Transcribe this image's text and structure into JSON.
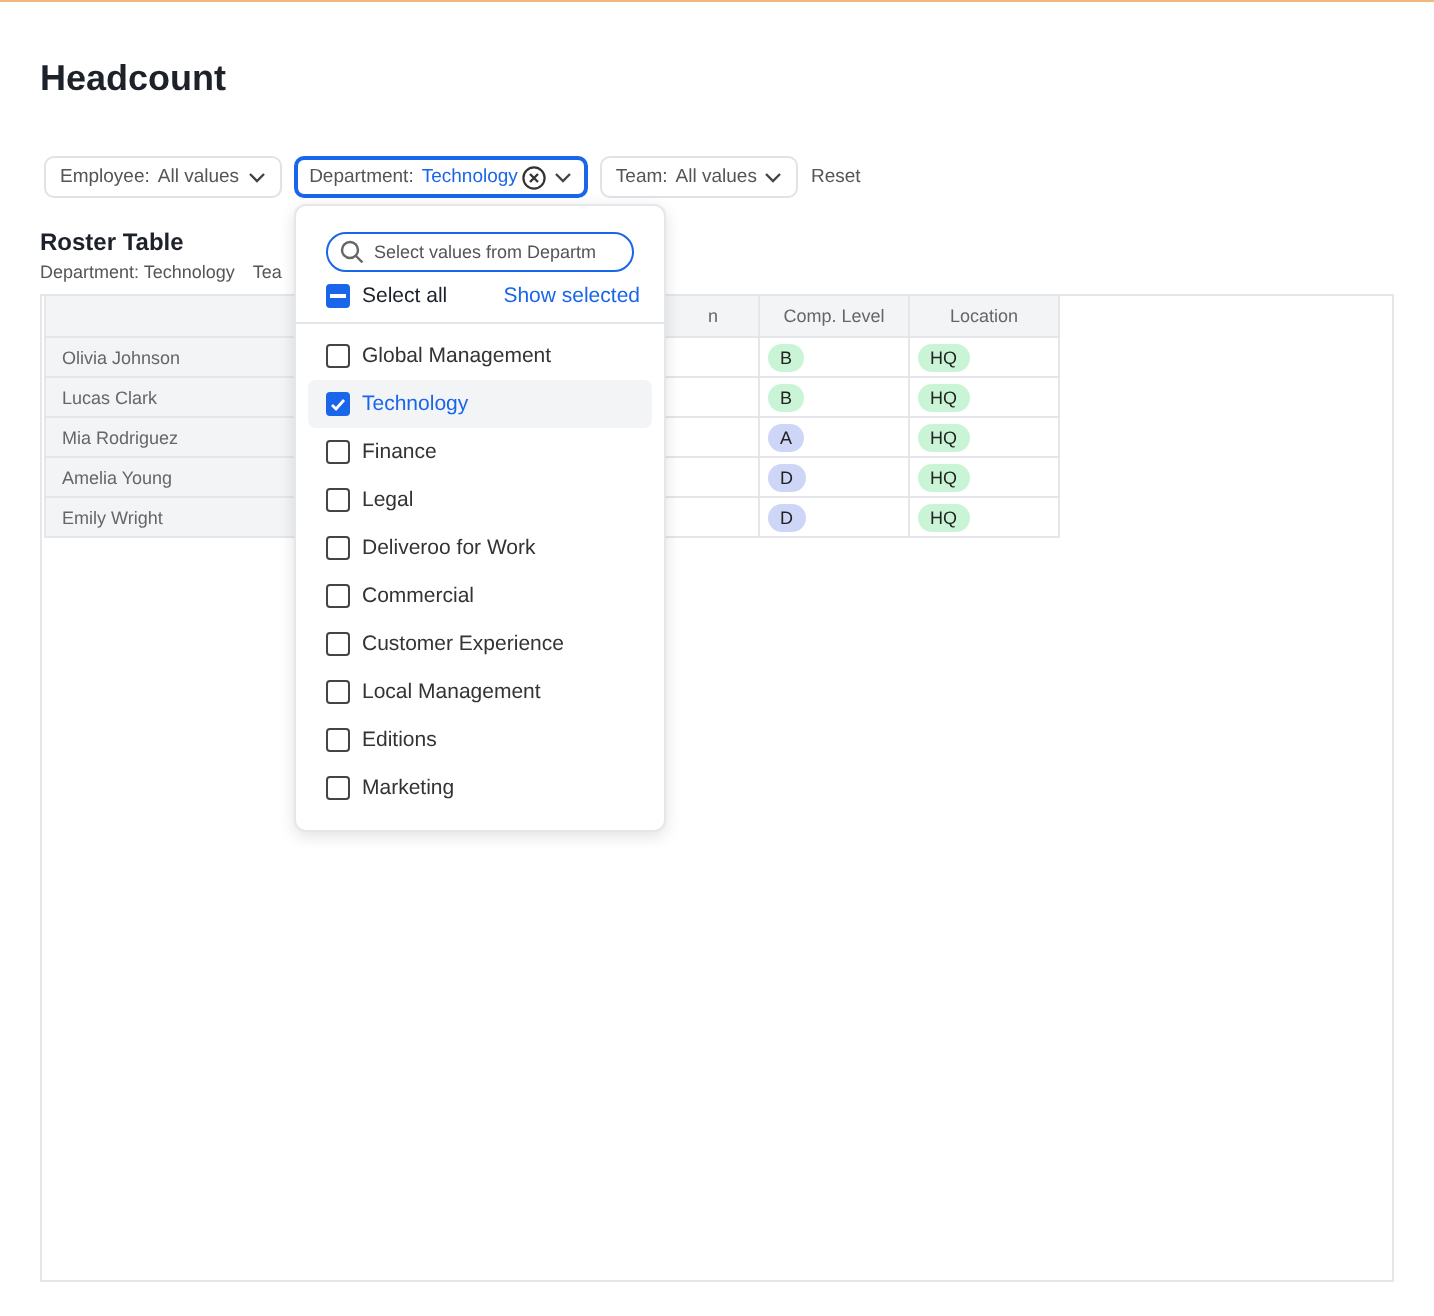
{
  "page": {
    "title": "Headcount"
  },
  "filters": [
    {
      "label": "Employee:",
      "value": "All values",
      "active": false,
      "clearable": false
    },
    {
      "label": "Department:",
      "value": "Technology",
      "active": true,
      "clearable": true
    },
    {
      "label": "Team:",
      "value": "All values",
      "active": false,
      "clearable": false
    }
  ],
  "reset": "Reset",
  "roster": {
    "title": "Roster Table",
    "subtitle": [
      "Department: Technology",
      "Tea"
    ],
    "columns": [
      "",
      "n",
      "Comp. Level",
      "Location"
    ],
    "rows": [
      {
        "name": "Olivia Johnson",
        "comp_level": {
          "text": "B",
          "color": "#c9f5d6"
        },
        "location": {
          "text": "HQ",
          "color": "#c9f5d6"
        }
      },
      {
        "name": "Lucas Clark",
        "comp_level": {
          "text": "B",
          "color": "#c9f5d6"
        },
        "location": {
          "text": "HQ",
          "color": "#c9f5d6"
        }
      },
      {
        "name": "Mia Rodriguez",
        "comp_level": {
          "text": "A",
          "color": "#cdd6f7"
        },
        "location": {
          "text": "HQ",
          "color": "#c9f5d6"
        }
      },
      {
        "name": "Amelia Young",
        "comp_level": {
          "text": "D",
          "color": "#cdd6f7"
        },
        "location": {
          "text": "HQ",
          "color": "#c9f5d6"
        }
      },
      {
        "name": "Emily Wright",
        "comp_level": {
          "text": "D",
          "color": "#cdd6f7"
        },
        "location": {
          "text": "HQ",
          "color": "#c9f5d6"
        }
      }
    ]
  },
  "dropdown": {
    "search": {
      "placeholder": "Select values from Departm"
    },
    "select_all": {
      "label": "Select all",
      "indeterminate": true
    },
    "show_selected": "Show selected",
    "options": [
      {
        "label": "Global Management",
        "checked": false
      },
      {
        "label": "Technology",
        "checked": true
      },
      {
        "label": "Finance",
        "checked": false
      },
      {
        "label": "Legal",
        "checked": false
      },
      {
        "label": "Deliveroo for Work",
        "checked": false
      },
      {
        "label": "Commercial",
        "checked": false
      },
      {
        "label": "Customer Experience",
        "checked": false
      },
      {
        "label": "Local Management",
        "checked": false
      },
      {
        "label": "Editions",
        "checked": false
      },
      {
        "label": "Marketing",
        "checked": false
      }
    ]
  }
}
